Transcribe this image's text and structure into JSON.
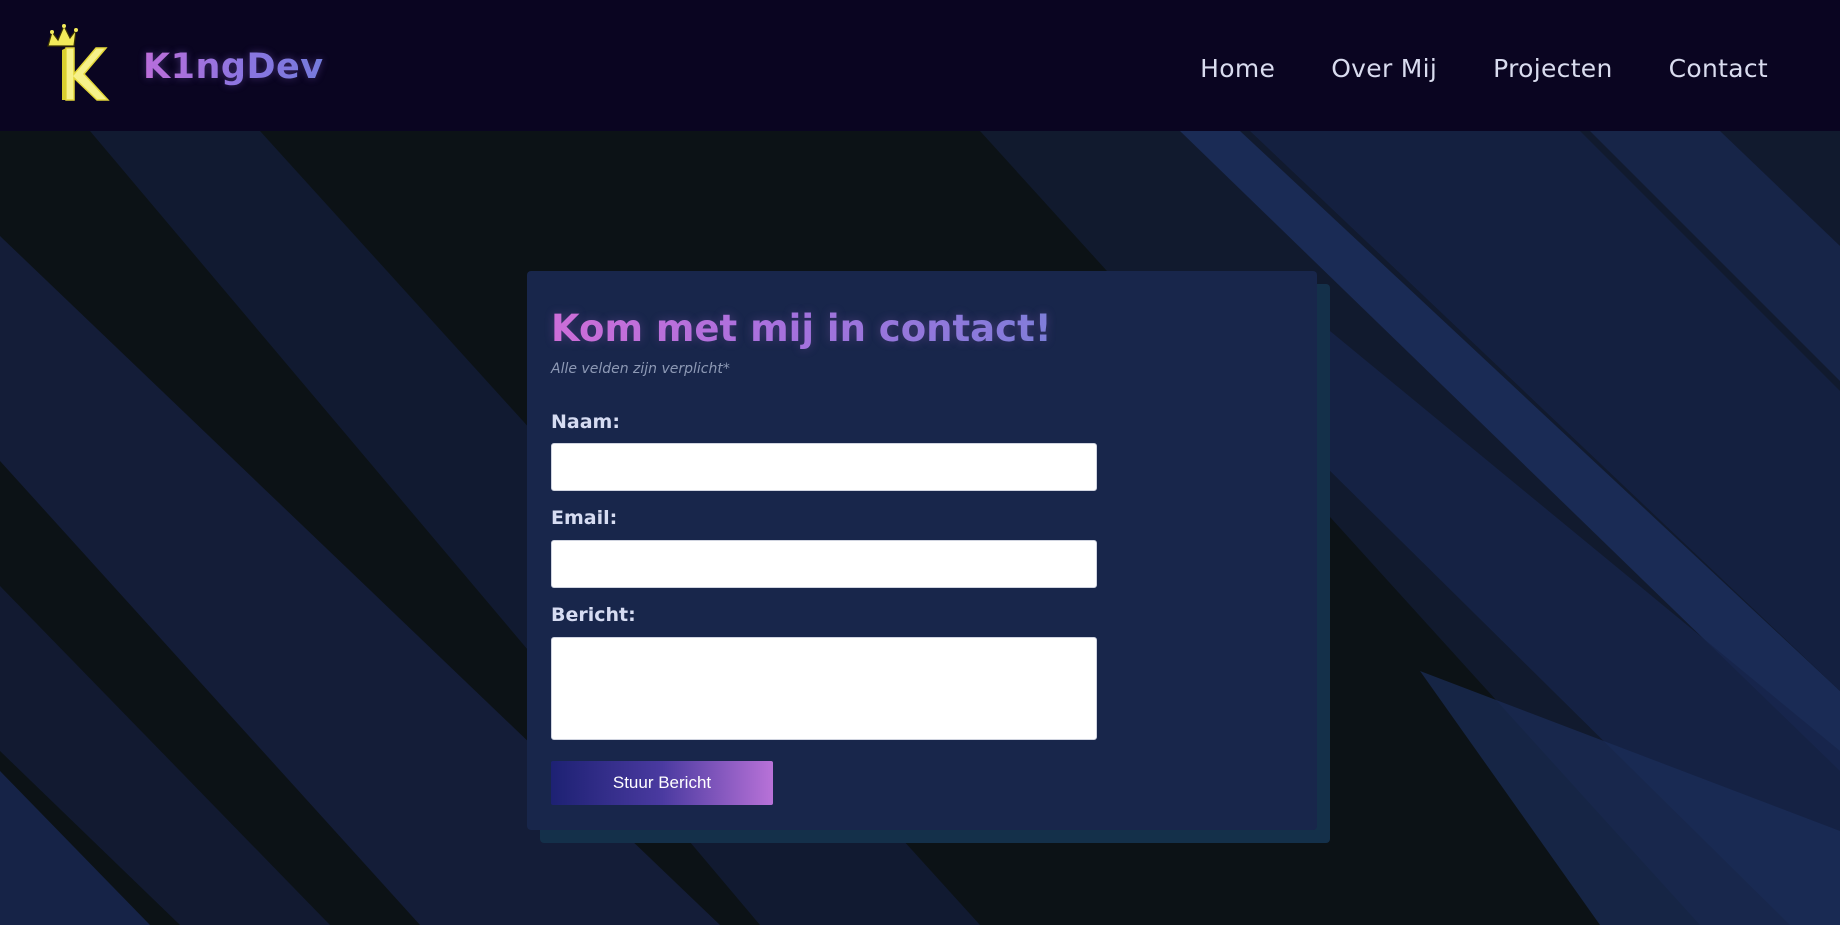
{
  "brand": {
    "name": "K1ngDev",
    "logo_icon": "crown-k-logo-icon"
  },
  "nav": {
    "items": [
      "Home",
      "Over Mij",
      "Projecten",
      "Contact"
    ]
  },
  "form": {
    "title": "Kom met mij in contact!",
    "subtitle": "Alle velden zijn verplicht*",
    "fields": {
      "name": {
        "label": "Naam:",
        "value": ""
      },
      "email": {
        "label": "Email:",
        "value": ""
      },
      "message": {
        "label": "Bericht:",
        "value": ""
      }
    },
    "submit_label": "Stuur Bericht"
  },
  "colors": {
    "header_bg": "#0a0521",
    "card_bg": "#18264b",
    "accent_pink": "#c66fd8",
    "accent_blue": "#6f7fdb",
    "logo_yellow": "#f2ea5a"
  }
}
